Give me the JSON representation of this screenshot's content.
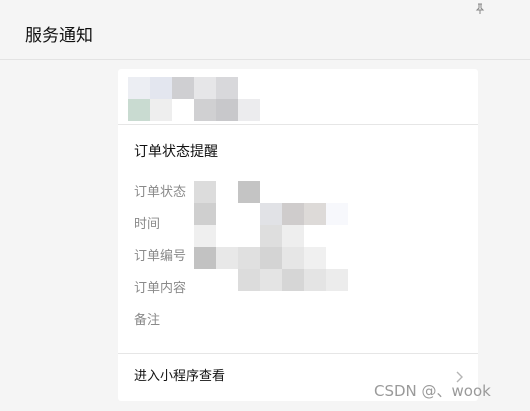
{
  "window": {
    "title": "服务通知",
    "pin_icon": "pin-icon"
  },
  "notice": {
    "title": "订单状态提醒",
    "fields": [
      {
        "label": "订单状态"
      },
      {
        "label": "时间"
      },
      {
        "label": "订单编号"
      },
      {
        "label": "订单内容"
      },
      {
        "label": "备注"
      }
    ],
    "footer_label": "进入小程序查看",
    "chevron_icon": "chevron-right-icon"
  },
  "watermark": "CSDN @、wook",
  "colors": {
    "page_background": "#f5f5f5",
    "card_background": "#ffffff",
    "label_gray": "#8a8a8a"
  }
}
